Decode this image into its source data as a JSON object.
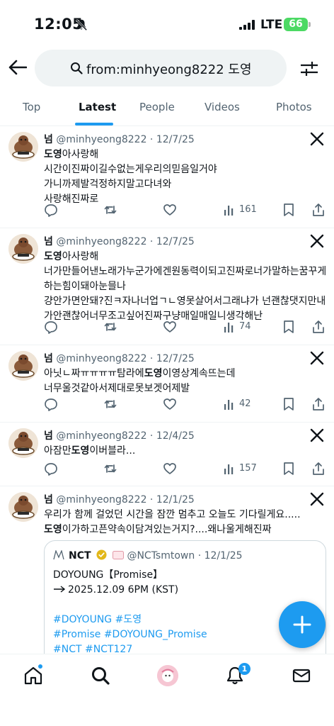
{
  "status_bar": {
    "time": "12:05",
    "network": "LTE",
    "battery": "66"
  },
  "search": {
    "query": "from:minhyeong8222 도영"
  },
  "tabs": [
    {
      "label": "Top"
    },
    {
      "label": "Latest"
    },
    {
      "label": "People"
    },
    {
      "label": "Videos"
    },
    {
      "label": "Photos"
    }
  ],
  "tweets": [
    {
      "name": "넘",
      "meta": "@minhyeong8222 · 12/7/25",
      "highlight": "도영",
      "text_after": "아사랑해",
      "text_lines": [
        "시간이진짜이길수없는게우리의믿음일거야",
        "가니까제발걱정하지말고다녀와",
        "사랑해진짜로"
      ],
      "views": "161"
    },
    {
      "name": "넘",
      "meta": "@minhyeong8222 · 12/7/25",
      "highlight": "도영",
      "text_after": "아사랑해",
      "text_lines": [
        "너가만들어낸노래가누군가에겐원동력이되고진짜로너가말하는꿈꾸게하는힘이돼아눈믈나",
        "걍안가면안돼?진ㅋ자나너업ㄱㄴ영못살어서그래냐가 넌괜찮댓지만내가안괜찮어너무조고싶어진짜구냥매일매일니생각해난"
      ],
      "views": "74"
    },
    {
      "name": "넘",
      "meta": "@minhyeong8222 · 12/7/25",
      "text_before": "아닛ㄴ짜ㅠㅠㅠㅠ탐라에",
      "highlight": "도영",
      "text_after": "이영상계속뜨는데",
      "text_lines": [
        "너무울것같아서제대로못보겟어제발"
      ],
      "views": "42"
    },
    {
      "name": "넘",
      "meta": "@minhyeong8222 · 12/4/25",
      "text_before": "아잠만",
      "highlight": "도영",
      "text_after": "이버블라...",
      "views": "157"
    },
    {
      "name": "넘",
      "meta": "@minhyeong8222 · 12/1/25",
      "line1": "우리가 함께 걸었던 시간을 잠깐 멈추고 오늘도 기다릴게요.....",
      "highlight": "도영",
      "text_after": "이가하고픈약속이담겨있는거지?....왜나울게해진짜",
      "quote": {
        "name": "NCT",
        "meta": "@NCTsmtown · 12/1/25",
        "line1": "DOYOUNG【Promise】",
        "line2": "2025.12.09 6PM (KST)",
        "tags1": "#DOYOUNG #도영",
        "tags2": "#Promise #DOYOUNG_Promise",
        "tags3": "#NCT #NCT127"
      }
    }
  ],
  "notifications_badge": "1",
  "colors": {
    "accent": "#1d9bf0",
    "secondary_text": "#536471",
    "battery": "#4cd964"
  }
}
